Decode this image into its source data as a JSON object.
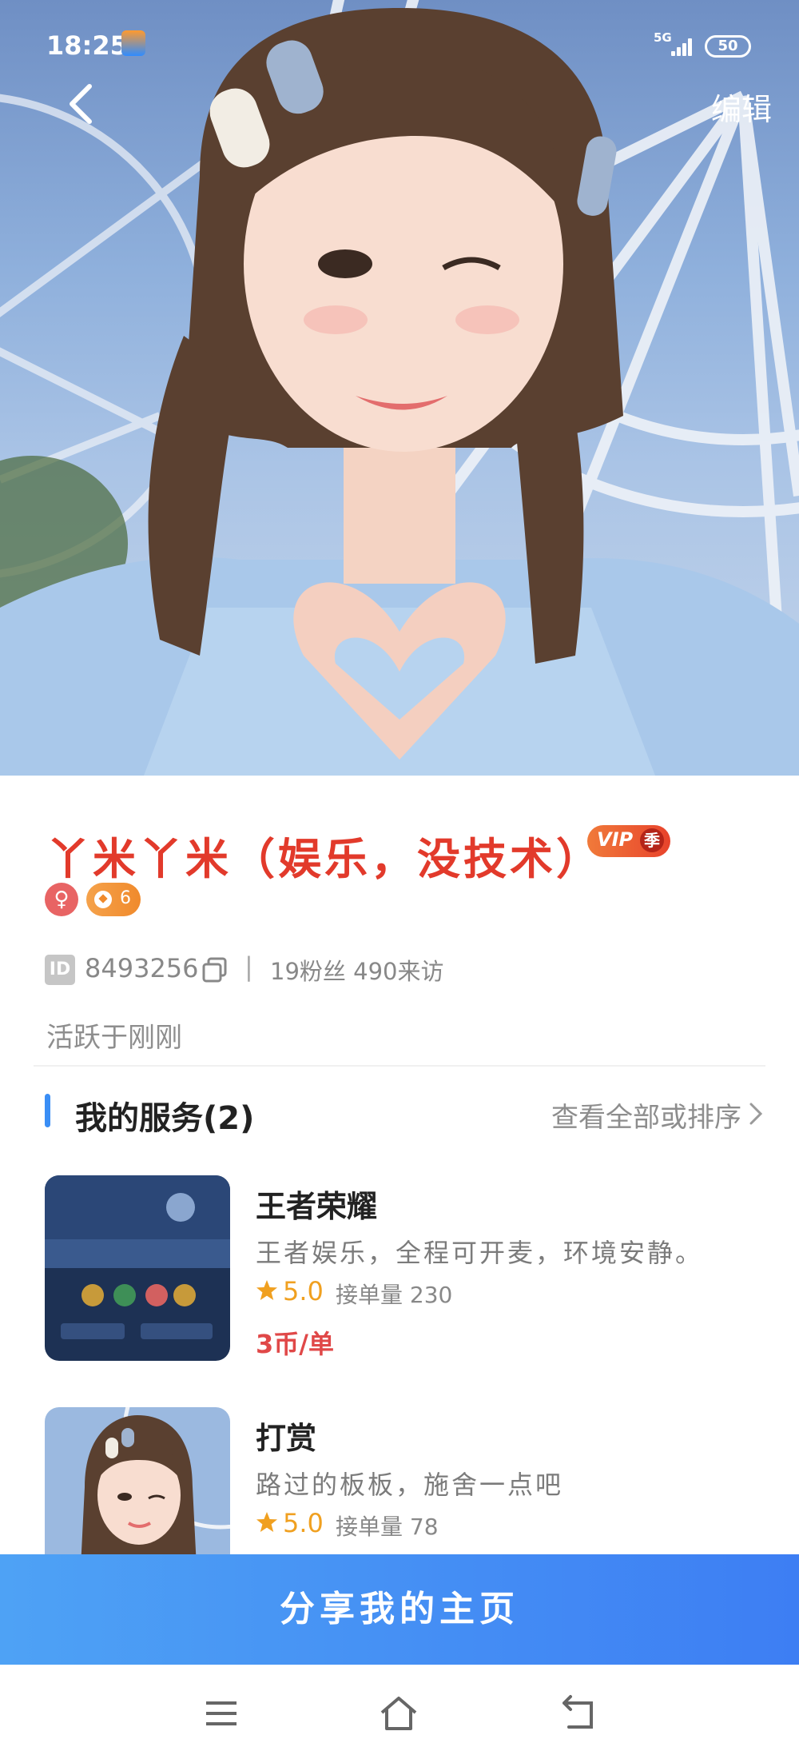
{
  "status_bar": {
    "time": "18:25",
    "network": "5G",
    "battery": "50"
  },
  "header": {
    "edit_label": "编辑"
  },
  "profile": {
    "nickname": "丫米丫米（娱乐，没技术）",
    "vip_label": "VIP",
    "vip_sub": "季",
    "gender_symbol": "♀",
    "level": "6",
    "id_badge": "ID",
    "id_value": "8493256",
    "separator": "|",
    "fans_visitors": "19粉丝 490来访",
    "active_status": "活跃于刚刚"
  },
  "services": {
    "title": "我的服务(2)",
    "view_all": "查看全部或排序",
    "items": [
      {
        "name": "王者荣耀",
        "description": "王者娱乐，全程可开麦，环境安静。",
        "rating": "5.0",
        "orders": "接单量 230",
        "price": "3币/单",
        "thumb": "game-screenshot"
      },
      {
        "name": "打赏",
        "description": "路过的板板，施舍一点吧",
        "rating": "5.0",
        "orders": "接单量 78",
        "price": "",
        "thumb": "profile-photo"
      }
    ]
  },
  "share_button": "分享我的主页",
  "colors": {
    "accent": "#3d7ef3",
    "nickname": "#e23a2b",
    "price": "#e04848",
    "rating": "#f0a020"
  },
  "icons": [
    "back-arrow-icon",
    "copy-icon",
    "chevron-right-icon",
    "star-icon",
    "menu-icon",
    "home-icon",
    "back-icon"
  ]
}
